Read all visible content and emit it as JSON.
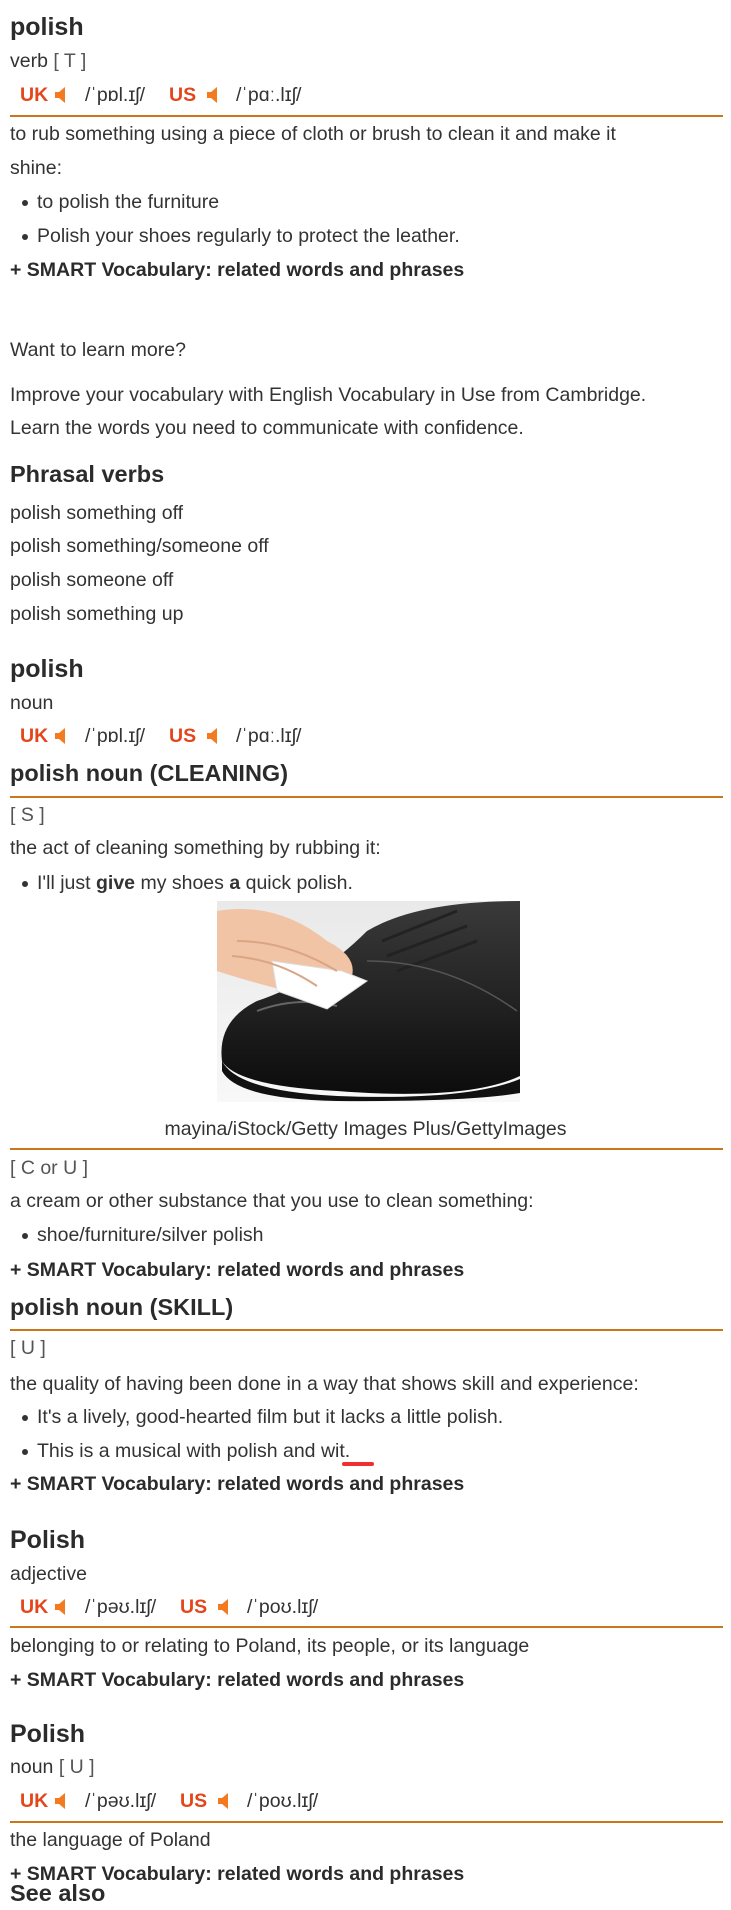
{
  "entries": [
    {
      "headword": "polish",
      "pos": "verb",
      "grammar": "[ T ]",
      "pron": {
        "uk_label": "UK",
        "uk_ipa": "/ˈpɒl.ɪʃ/",
        "us_label": "US",
        "us_ipa": "/ˈpɑː.lɪʃ/"
      },
      "definition_line1": "to rub something using a piece of cloth or brush to clean it and make it",
      "definition_line2": "shine:",
      "examples": [
        "to polish the furniture",
        "Polish your shoes regularly to protect the leather."
      ],
      "smart": "+ SMART Vocabulary: related words and phrases"
    }
  ],
  "promo": {
    "title": "Want to learn more?",
    "line1": "Improve your vocabulary with English Vocabulary in Use from Cambridge.",
    "line2": "Learn the words you need to communicate with confidence."
  },
  "phrasal_verbs": {
    "title": "Phrasal verbs",
    "items": [
      "polish something off",
      "polish something/someone off",
      "polish someone off",
      "polish something up"
    ]
  },
  "noun": {
    "headword": "polish",
    "pos": "noun",
    "pron": {
      "uk_label": "UK",
      "uk_ipa": "/ˈpɒl.ɪʃ/",
      "us_label": "US",
      "us_ipa": "/ˈpɑː.lɪʃ/"
    },
    "cleaning": {
      "title": "polish noun (CLEANING)",
      "sense1": {
        "grammar": "[ S ]",
        "definition": "the act of cleaning something by rubbing it:",
        "example": {
          "pre": "I'll just ",
          "b1": "give",
          "mid": " my shoes ",
          "b2": "a",
          "post": " quick polish."
        }
      },
      "image_caption": "mayina/iStock/Getty Images Plus/GettyImages",
      "sense2": {
        "grammar": "[ C or U ]",
        "definition": "a cream or other substance that you use to clean something:",
        "example": "shoe/furniture/silver polish",
        "smart": "+ SMART Vocabulary: related words and phrases"
      }
    },
    "skill": {
      "title": "polish noun (SKILL)",
      "grammar": "[ U ]",
      "definition": "the quality of having been done in a way that shows skill and experience:",
      "examples": [
        "It's a lively, good-hearted film but it lacks a little polish.",
        "This is a musical with polish and wit."
      ],
      "smart": "+ SMART Vocabulary: related words and phrases"
    }
  },
  "adjective": {
    "headword": "Polish",
    "pos": "adjective",
    "pron": {
      "uk_label": "UK",
      "uk_ipa": "/ˈpəʊ.lɪʃ/",
      "us_label": "US",
      "us_ipa": "/ˈpoʊ.lɪʃ/"
    },
    "definition": "belonging to or relating to Poland, its people, or its language",
    "smart": "+ SMART Vocabulary: related words and phrases"
  },
  "language_noun": {
    "headword": "Polish",
    "pos": "noun",
    "grammar": "[ U ]",
    "pron": {
      "uk_label": "UK",
      "uk_ipa": "/ˈpəʊ.lɪʃ/",
      "us_label": "US",
      "us_ipa": "/ˈpoʊ.lɪʃ/"
    },
    "definition": "the language of Poland",
    "smart": "+ SMART Vocabulary: related words and phrases"
  },
  "see_also": "See also",
  "colors": {
    "region": "#e4461c",
    "speaker": "#f47a20",
    "rule": "#c9761d",
    "text": "#333333"
  }
}
